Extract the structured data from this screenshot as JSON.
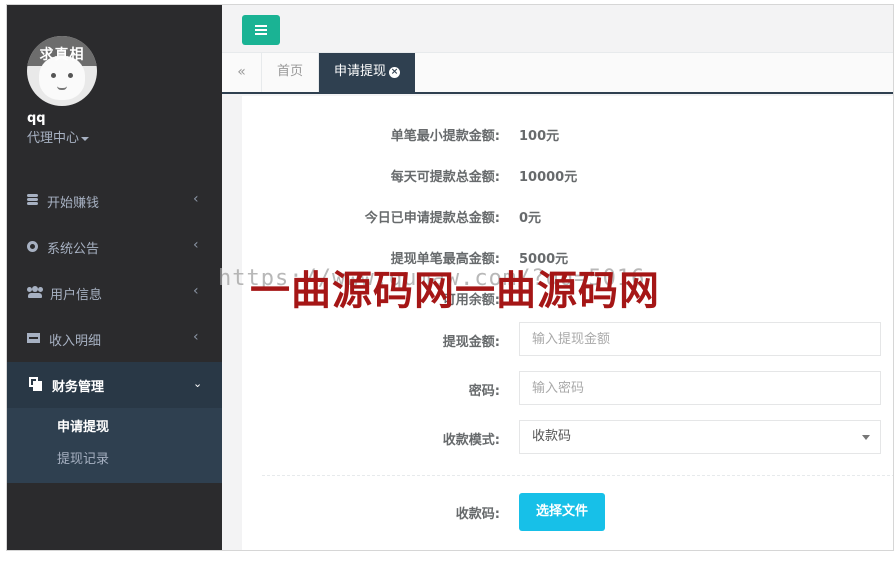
{
  "sidebar": {
    "avatar_text": "求真相",
    "username": "qq",
    "role_menu": "代理中心",
    "items": [
      {
        "label": "开始赚钱",
        "icon": "database-icon"
      },
      {
        "label": "系统公告",
        "icon": "gear-icon"
      },
      {
        "label": "用户信息",
        "icon": "users-icon"
      },
      {
        "label": "收入明细",
        "icon": "credit-card-icon"
      },
      {
        "label": "财务管理",
        "icon": "copy-icon"
      }
    ],
    "sub_items": [
      {
        "label": "申请提现"
      },
      {
        "label": "提现记录"
      }
    ]
  },
  "tabs": {
    "home": "首页",
    "active": "申请提现"
  },
  "form": {
    "min_label": "单笔最小提款金额:",
    "min_value": "100元",
    "daily_label": "每天可提款总金额:",
    "daily_value": "10000元",
    "today_label": "今日已申请提款总金额:",
    "today_value": "0元",
    "max_label": "提现单笔最高金额:",
    "max_value": "5000元",
    "balance_label": "可用余额:",
    "amount_label": "提现金额:",
    "amount_placeholder": "输入提现金额",
    "password_label": "密码:",
    "password_placeholder": "输入密码",
    "mode_label": "收款模式:",
    "mode_value": "收款码",
    "qr_label": "收款码:",
    "file_button": "选择文件"
  },
  "watermark": {
    "url": "https://www.qumaw.com/?qq=5016",
    "text": "一曲源码网一曲源码网"
  },
  "colors": {
    "sidebar_bg": "#2b2b2d",
    "sidebar_active": "#293846",
    "accent": "#1ab394",
    "file_button": "#17c0e8"
  }
}
